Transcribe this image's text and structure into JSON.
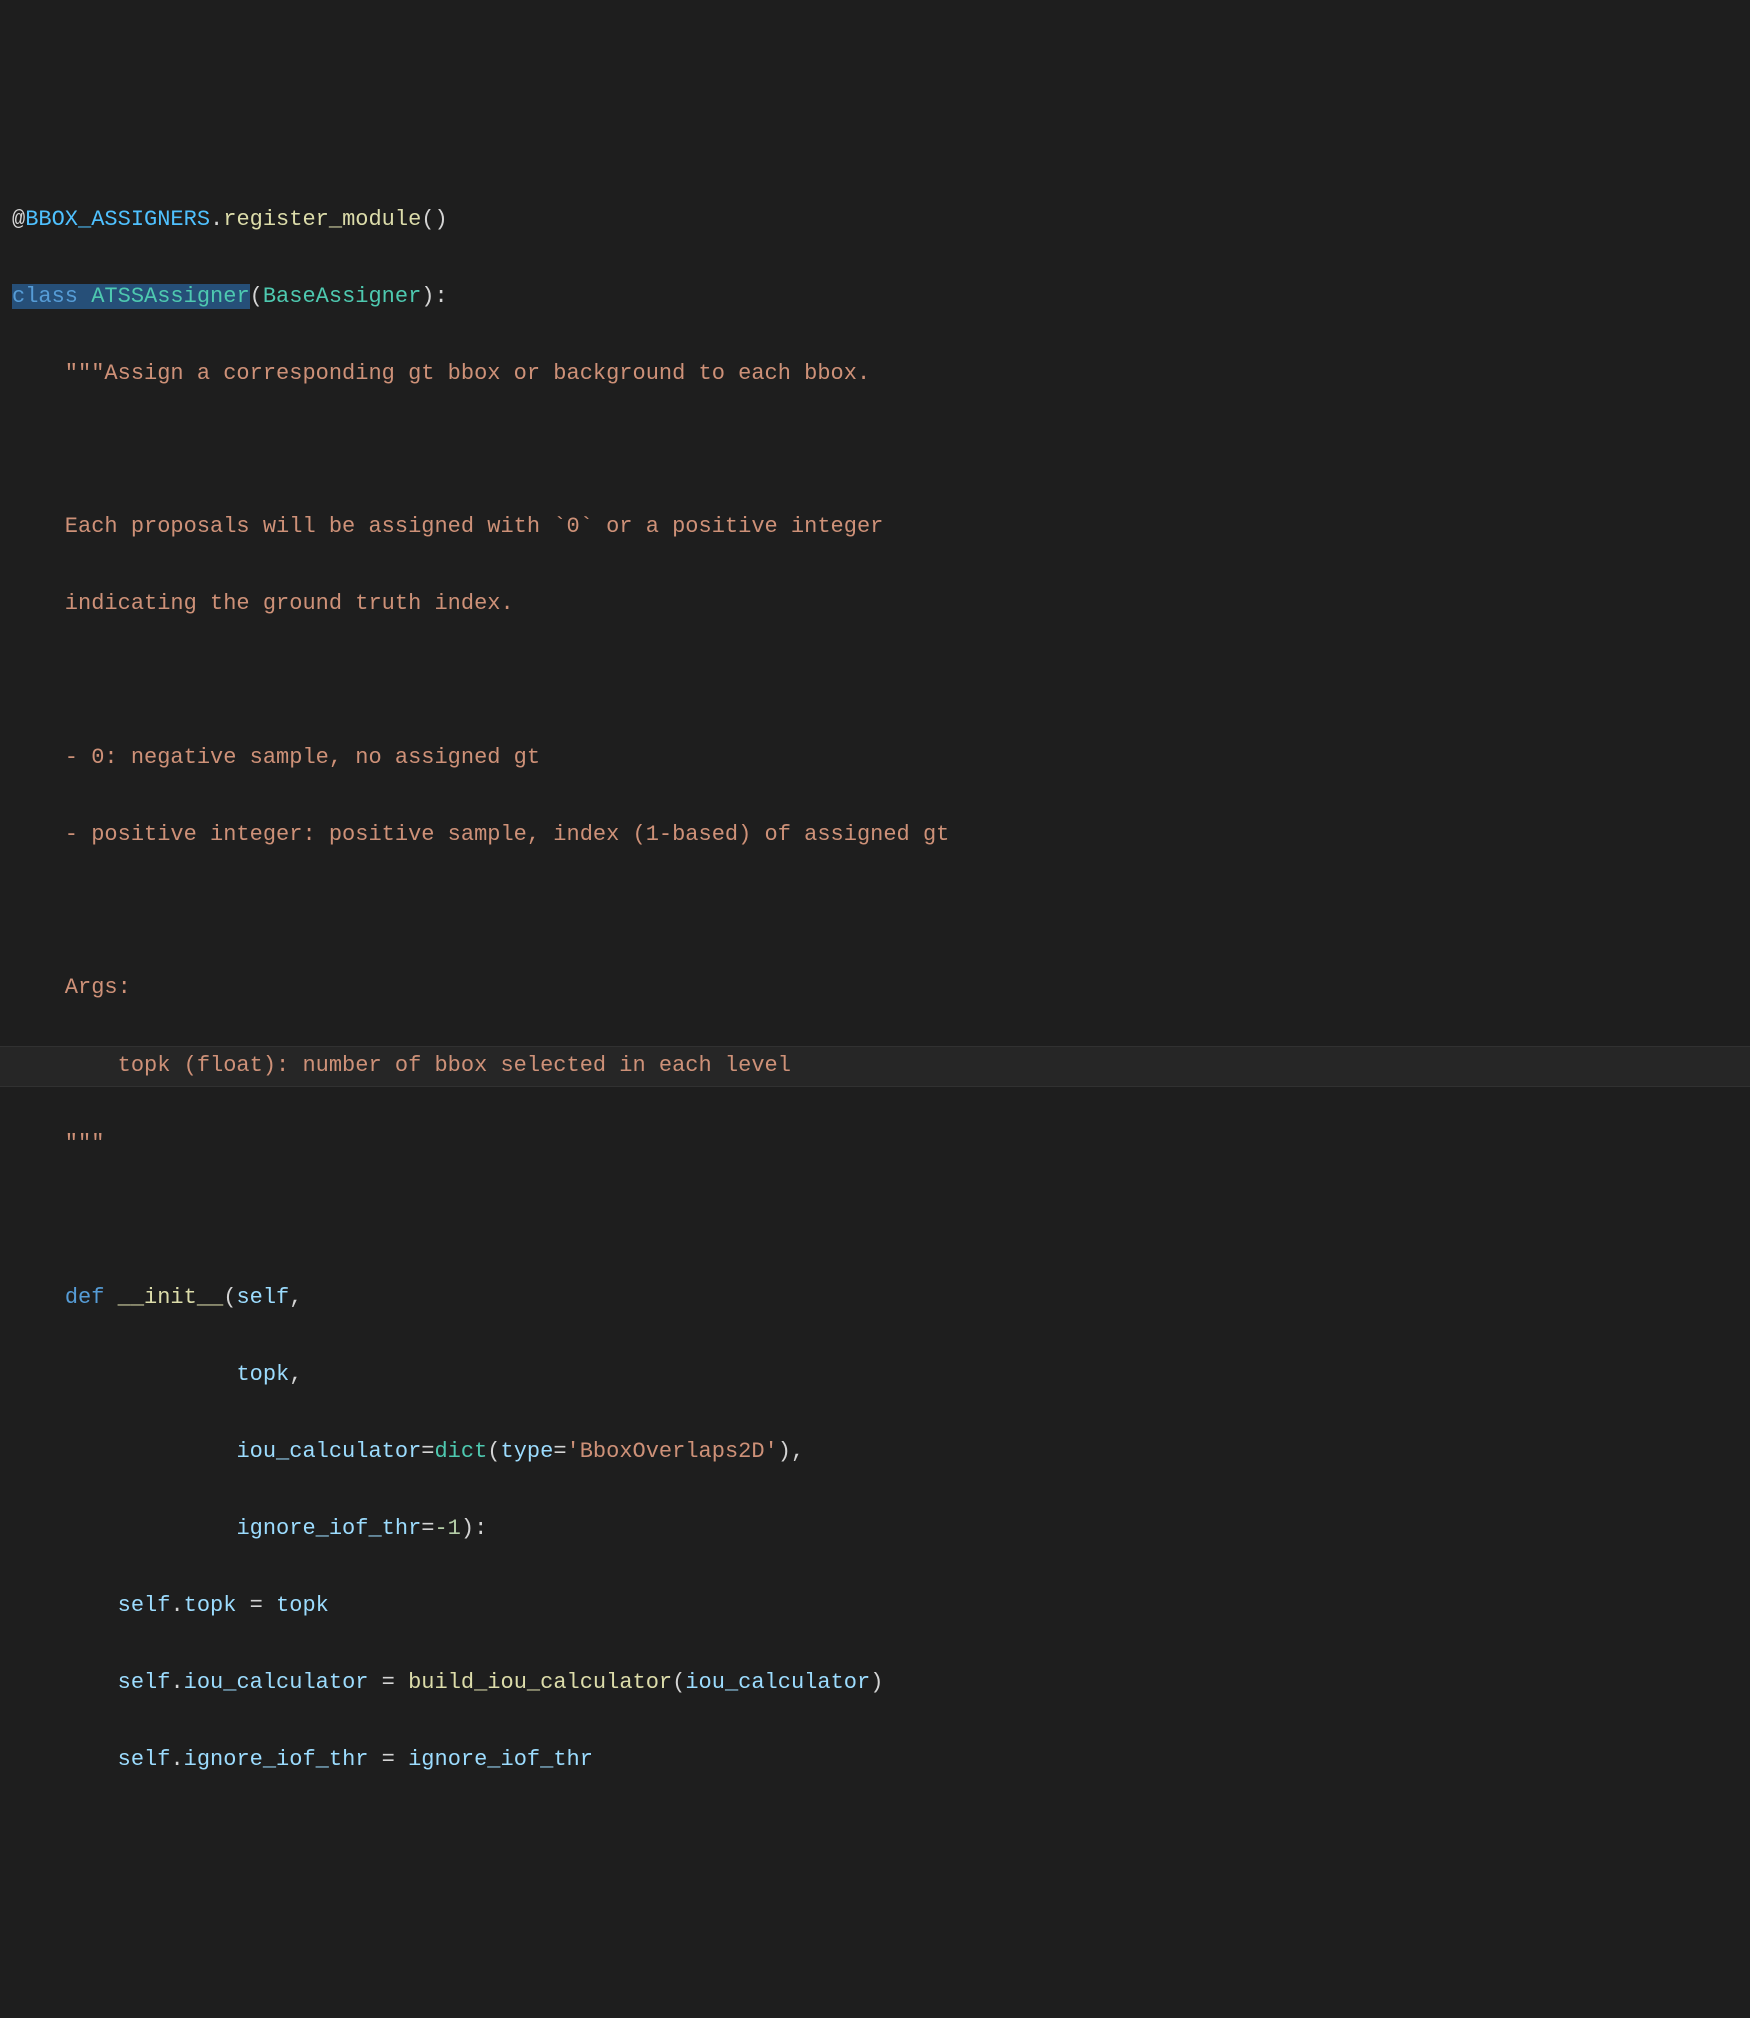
{
  "code": {
    "line1": {
      "at": "@",
      "decorator_obj": "BBOX_ASSIGNERS",
      "dot": ".",
      "method": "register_module",
      "parens": "()"
    },
    "line2": {
      "class_kw": "class",
      "class_name": "ATSSAssigner",
      "open": "(",
      "base": "BaseAssigner",
      "close": "):"
    },
    "docstring": {
      "l1": "    \"\"\"Assign a corresponding gt bbox or background to each bbox.",
      "l2": "",
      "l3": "    Each proposals will be assigned with `0` or a positive integer",
      "l4": "    indicating the ground truth index.",
      "l5": "",
      "l6": "    - 0: negative sample, no assigned gt",
      "l7": "    - positive integer: positive sample, index (1-based) of assigned gt",
      "l8": "",
      "l9": "    Args:",
      "l10": "        topk (float): number of bbox selected in each level",
      "l11": "    \"\"\""
    },
    "blank": "",
    "method": {
      "def_kw": "def",
      "name": "__init__",
      "open": "(",
      "self": "self",
      "comma": ",",
      "topk": "topk",
      "iou_calculator": "iou_calculator",
      "eq": "=",
      "dict": "dict",
      "type_kw": "type",
      "type_val": "'BboxOverlaps2D'",
      "close_dict": ")",
      "ignore_iof_thr": "ignore_iof_thr",
      "neg1": "-1",
      "close": "):"
    },
    "body": {
      "self": "self",
      "dot": ".",
      "eq_sp": " = ",
      "topk": "topk",
      "iou_calculator": "iou_calculator",
      "build_fn": "build_iou_calculator",
      "open": "(",
      "close": ")",
      "ignore_iof_thr": "ignore_iof_thr"
    }
  }
}
